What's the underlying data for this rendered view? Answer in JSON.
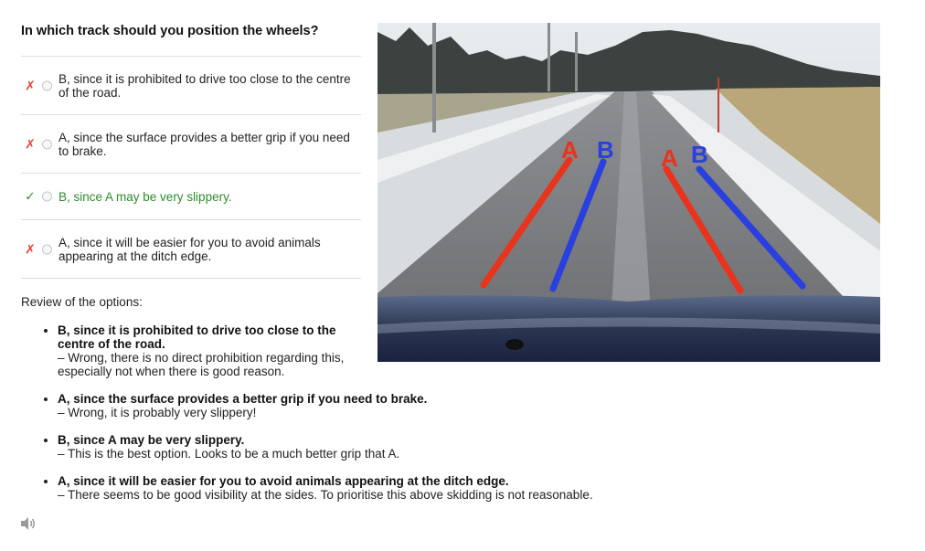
{
  "question": "In which track should you position the wheels?",
  "options": [
    {
      "mark": "✗",
      "status": "wrong",
      "text": "B, since it is prohibited to drive too close to the centre of the road."
    },
    {
      "mark": "✗",
      "status": "wrong",
      "text": "A, since the surface provides a better grip if you need to brake."
    },
    {
      "mark": "✓",
      "status": "correct",
      "text": "B, since A may be very slippery."
    },
    {
      "mark": "✗",
      "status": "wrong",
      "text": "A, since it will be easier for you to avoid animals appearing at the ditch edge."
    }
  ],
  "review": {
    "heading": "Review of the options:",
    "items": [
      {
        "option": "B, since it is prohibited to drive too close to the centre of the road.",
        "comment": "– Wrong, there is no direct prohibition regarding this, especially not when there is good reason."
      },
      {
        "option": "A, since the surface provides a better grip if you need to brake.",
        "comment": "– Wrong, it is probably very slippery!"
      },
      {
        "option": "B, since A may be very slippery.",
        "comment": "– This is the best option. Looks to be a much better grip that A."
      },
      {
        "option": "A, since it will be easier for you to avoid animals appearing at the ditch edge.",
        "comment": "– There seems to be good visibility at the sides. To prioritise this above skidding is not reasonable."
      }
    ]
  },
  "image": {
    "labels": [
      "A",
      "B",
      "A",
      "B"
    ],
    "colors": {
      "track_a": "#e8341c",
      "track_b": "#2a3fe0"
    }
  },
  "icons": {
    "audio": "speaker-icon"
  },
  "colors": {
    "wrong_mark": "#e0463b",
    "correct_mark": "#2e9a2e",
    "correct_text": "#2e8b2e"
  }
}
